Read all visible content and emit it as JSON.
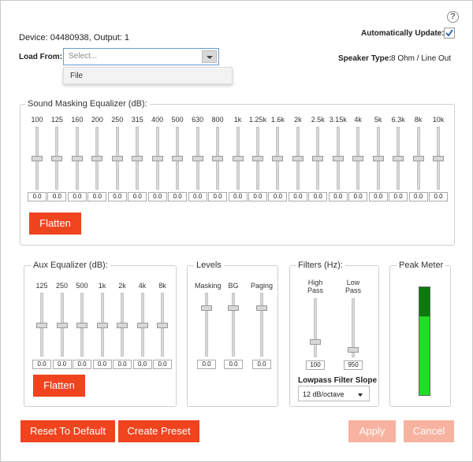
{
  "device_line": "Device: 04480938, Output: 1",
  "help_glyph": "?",
  "auto_update": {
    "label": "Automatically Update:",
    "checked": true
  },
  "load_from": {
    "label": "Load From:",
    "placeholder": "Select...",
    "options": [
      "File"
    ]
  },
  "speaker_type": {
    "label": "Speaker Type:",
    "value": "8 Ohm / Line Out"
  },
  "sound_masking": {
    "title": "Sound Masking Equalizer (dB):",
    "bands": [
      "100",
      "125",
      "160",
      "200",
      "250",
      "315",
      "400",
      "500",
      "630",
      "800",
      "1k",
      "1.25k",
      "1.6k",
      "2k",
      "2.5k",
      "3.15k",
      "4k",
      "5k",
      "6.3k",
      "8k",
      "10k"
    ],
    "values": [
      "0.0",
      "0.0",
      "0.0",
      "0.0",
      "0.0",
      "0.0",
      "0.0",
      "0.0",
      "0.0",
      "0.0",
      "0.0",
      "0.0",
      "0.0",
      "0.0",
      "0.0",
      "0.0",
      "0.0",
      "0.0",
      "0.0",
      "0.0",
      "0.0"
    ],
    "flatten_label": "Flatten"
  },
  "aux_eq": {
    "title": "Aux Equalizer (dB):",
    "bands": [
      "125",
      "250",
      "500",
      "1k",
      "2k",
      "4k",
      "8k"
    ],
    "values": [
      "0.0",
      "0.0",
      "0.0",
      "0.0",
      "0.0",
      "0.0",
      "0.0"
    ],
    "flatten_label": "Flatten"
  },
  "levels": {
    "title": "Levels",
    "channels": [
      "Masking",
      "BG",
      "Paging"
    ],
    "values": [
      "0.0",
      "0.0",
      "0.0"
    ]
  },
  "filters": {
    "title": "Filters (Hz):",
    "high_pass": {
      "label_line1": "High",
      "label_line2": "Pass",
      "value": "100"
    },
    "low_pass": {
      "label_line1": "Low",
      "label_line2": "Pass",
      "value": "950"
    },
    "slope_label": "Lowpass Filter Slope",
    "slope_value": "12 dB/octave"
  },
  "peak_meter": {
    "title": "Peak Meter",
    "level_fraction": 0.73,
    "peak_fraction": 0.27,
    "colors": {
      "fill": "#22dd22",
      "peak": "#0b7a0b",
      "border": "#666666"
    }
  },
  "buttons": {
    "reset": "Reset To Default",
    "create_preset": "Create Preset",
    "apply": "Apply",
    "cancel": "Cancel"
  },
  "colors": {
    "accent": "#f0441f",
    "accent_disabled": "#f7b3a0"
  }
}
